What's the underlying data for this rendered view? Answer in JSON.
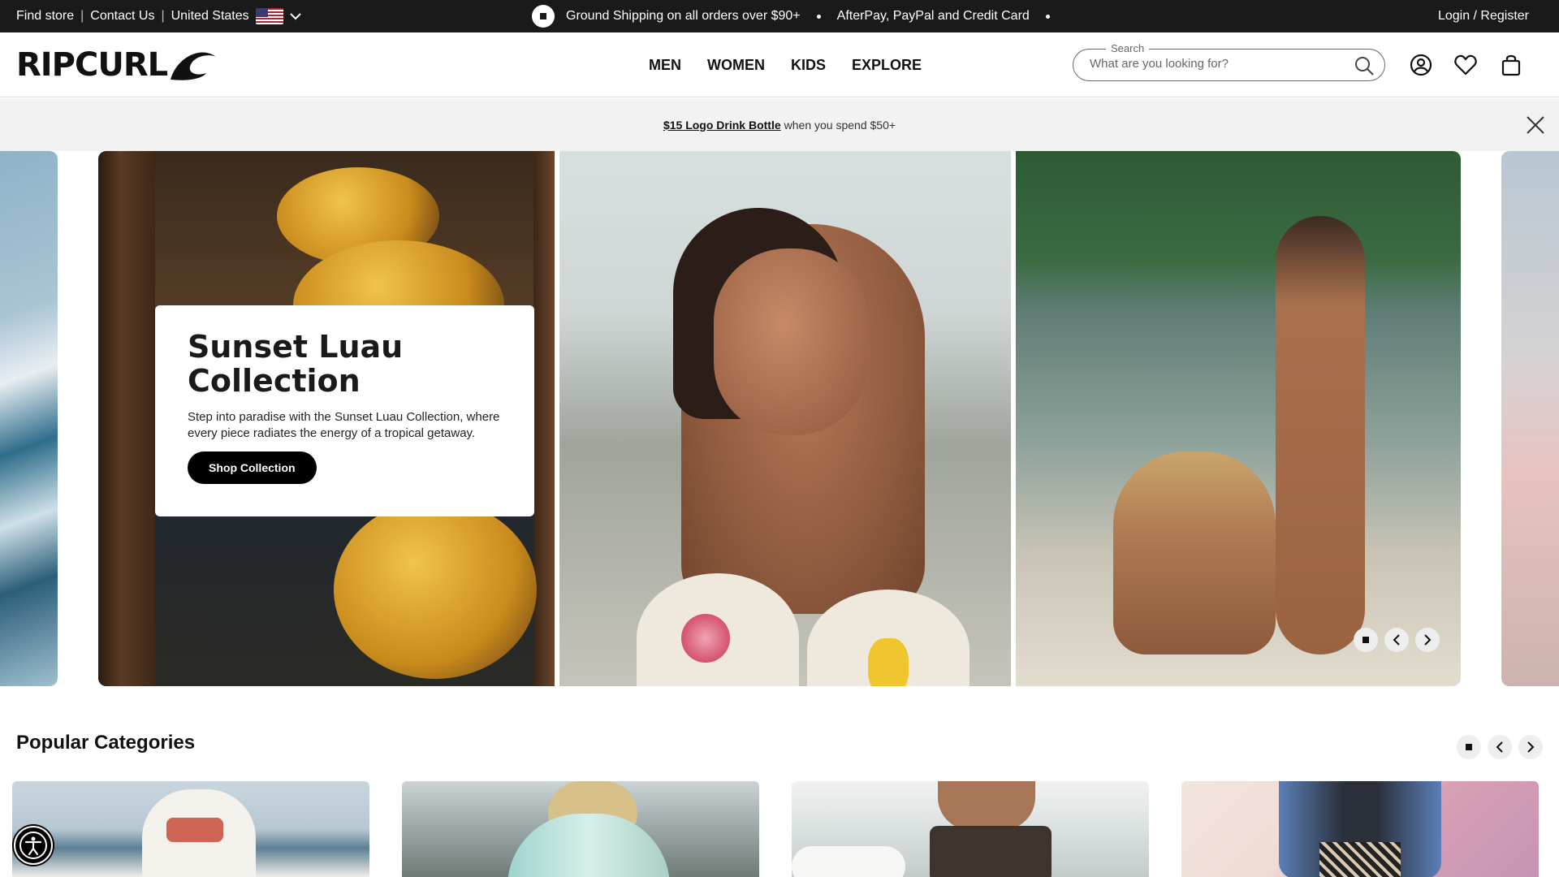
{
  "topbar": {
    "find_store": "Find store",
    "contact_us": "Contact Us",
    "country": "United States",
    "messages": [
      "Ground Shipping on all orders over $90+",
      "AfterPay, PayPal and Credit Card"
    ],
    "login": "Login / Register"
  },
  "header": {
    "logo": "RIPCURL",
    "nav": [
      "MEN",
      "WOMEN",
      "KIDS",
      "EXPLORE"
    ],
    "search": {
      "legend": "Search",
      "placeholder": "What are you looking for?"
    },
    "icons": [
      "account-icon",
      "wishlist-heart-icon",
      "bag-icon"
    ]
  },
  "promo": {
    "link": "$15 Logo Drink Bottle",
    "text": "when you spend $50+"
  },
  "hero": {
    "title_line1": "Sunset Luau",
    "title_line2": "Collection",
    "description": "Step into paradise with the Sunset Luau Collection, where every piece radiates the energy of a tropical getaway.",
    "cta": "Shop Collection"
  },
  "popular": {
    "title": "Popular Categories"
  },
  "colors": {
    "topbar_bg": "#1a1a1a",
    "promo_bg": "#f2f2f2",
    "cta_bg": "#000000"
  }
}
